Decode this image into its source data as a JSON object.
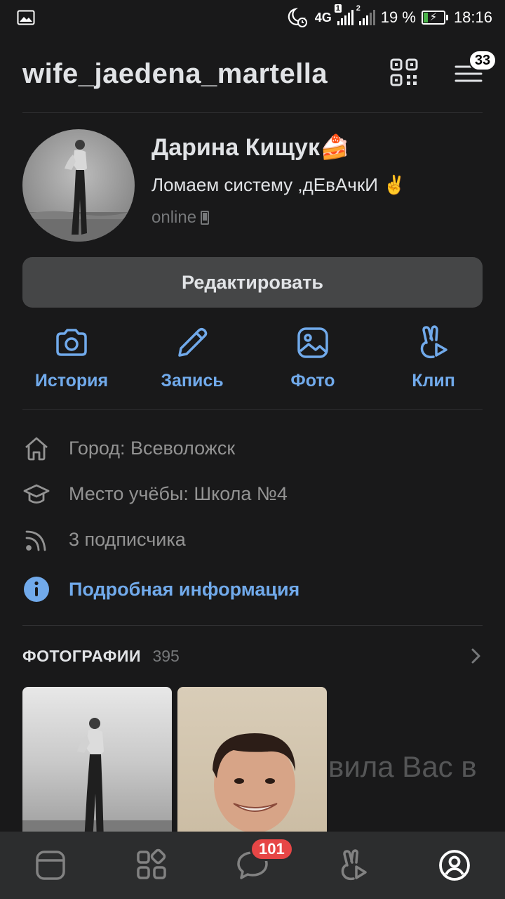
{
  "status_bar": {
    "network": "4G",
    "sim1": "1",
    "sim2": "2",
    "battery": "19 %",
    "time": "18:16"
  },
  "header": {
    "username": "wife_jaedena_martella",
    "menu_badge": "33"
  },
  "profile": {
    "name": "Дарина Кищук🍰",
    "status": "Ломаем систему ,дЕвАчкИ ✌️",
    "online": "online"
  },
  "edit_button": "Редактировать",
  "actions": [
    {
      "label": "История",
      "icon": "camera-icon"
    },
    {
      "label": "Запись",
      "icon": "pencil-icon"
    },
    {
      "label": "Фото",
      "icon": "image-icon"
    },
    {
      "label": "Клип",
      "icon": "clip-icon"
    }
  ],
  "info": {
    "city": "Город: Всеволожск",
    "school": "Место учёбы: Школа №4",
    "followers": "3 подписчика",
    "details_link": "Подробная информация"
  },
  "photos": {
    "title": "ФОТОГРАФИИ",
    "count": "395",
    "overlay_text": "вила Вас в"
  },
  "tabbar": {
    "messages_badge": "101",
    "tabs": [
      "news-tab",
      "services-tab",
      "messages-tab",
      "clips-tab",
      "profile-tab"
    ]
  },
  "colors": {
    "background": "#19191a",
    "accent": "#71aaeb",
    "badge_red": "#e64646",
    "button_bg": "#454647"
  }
}
